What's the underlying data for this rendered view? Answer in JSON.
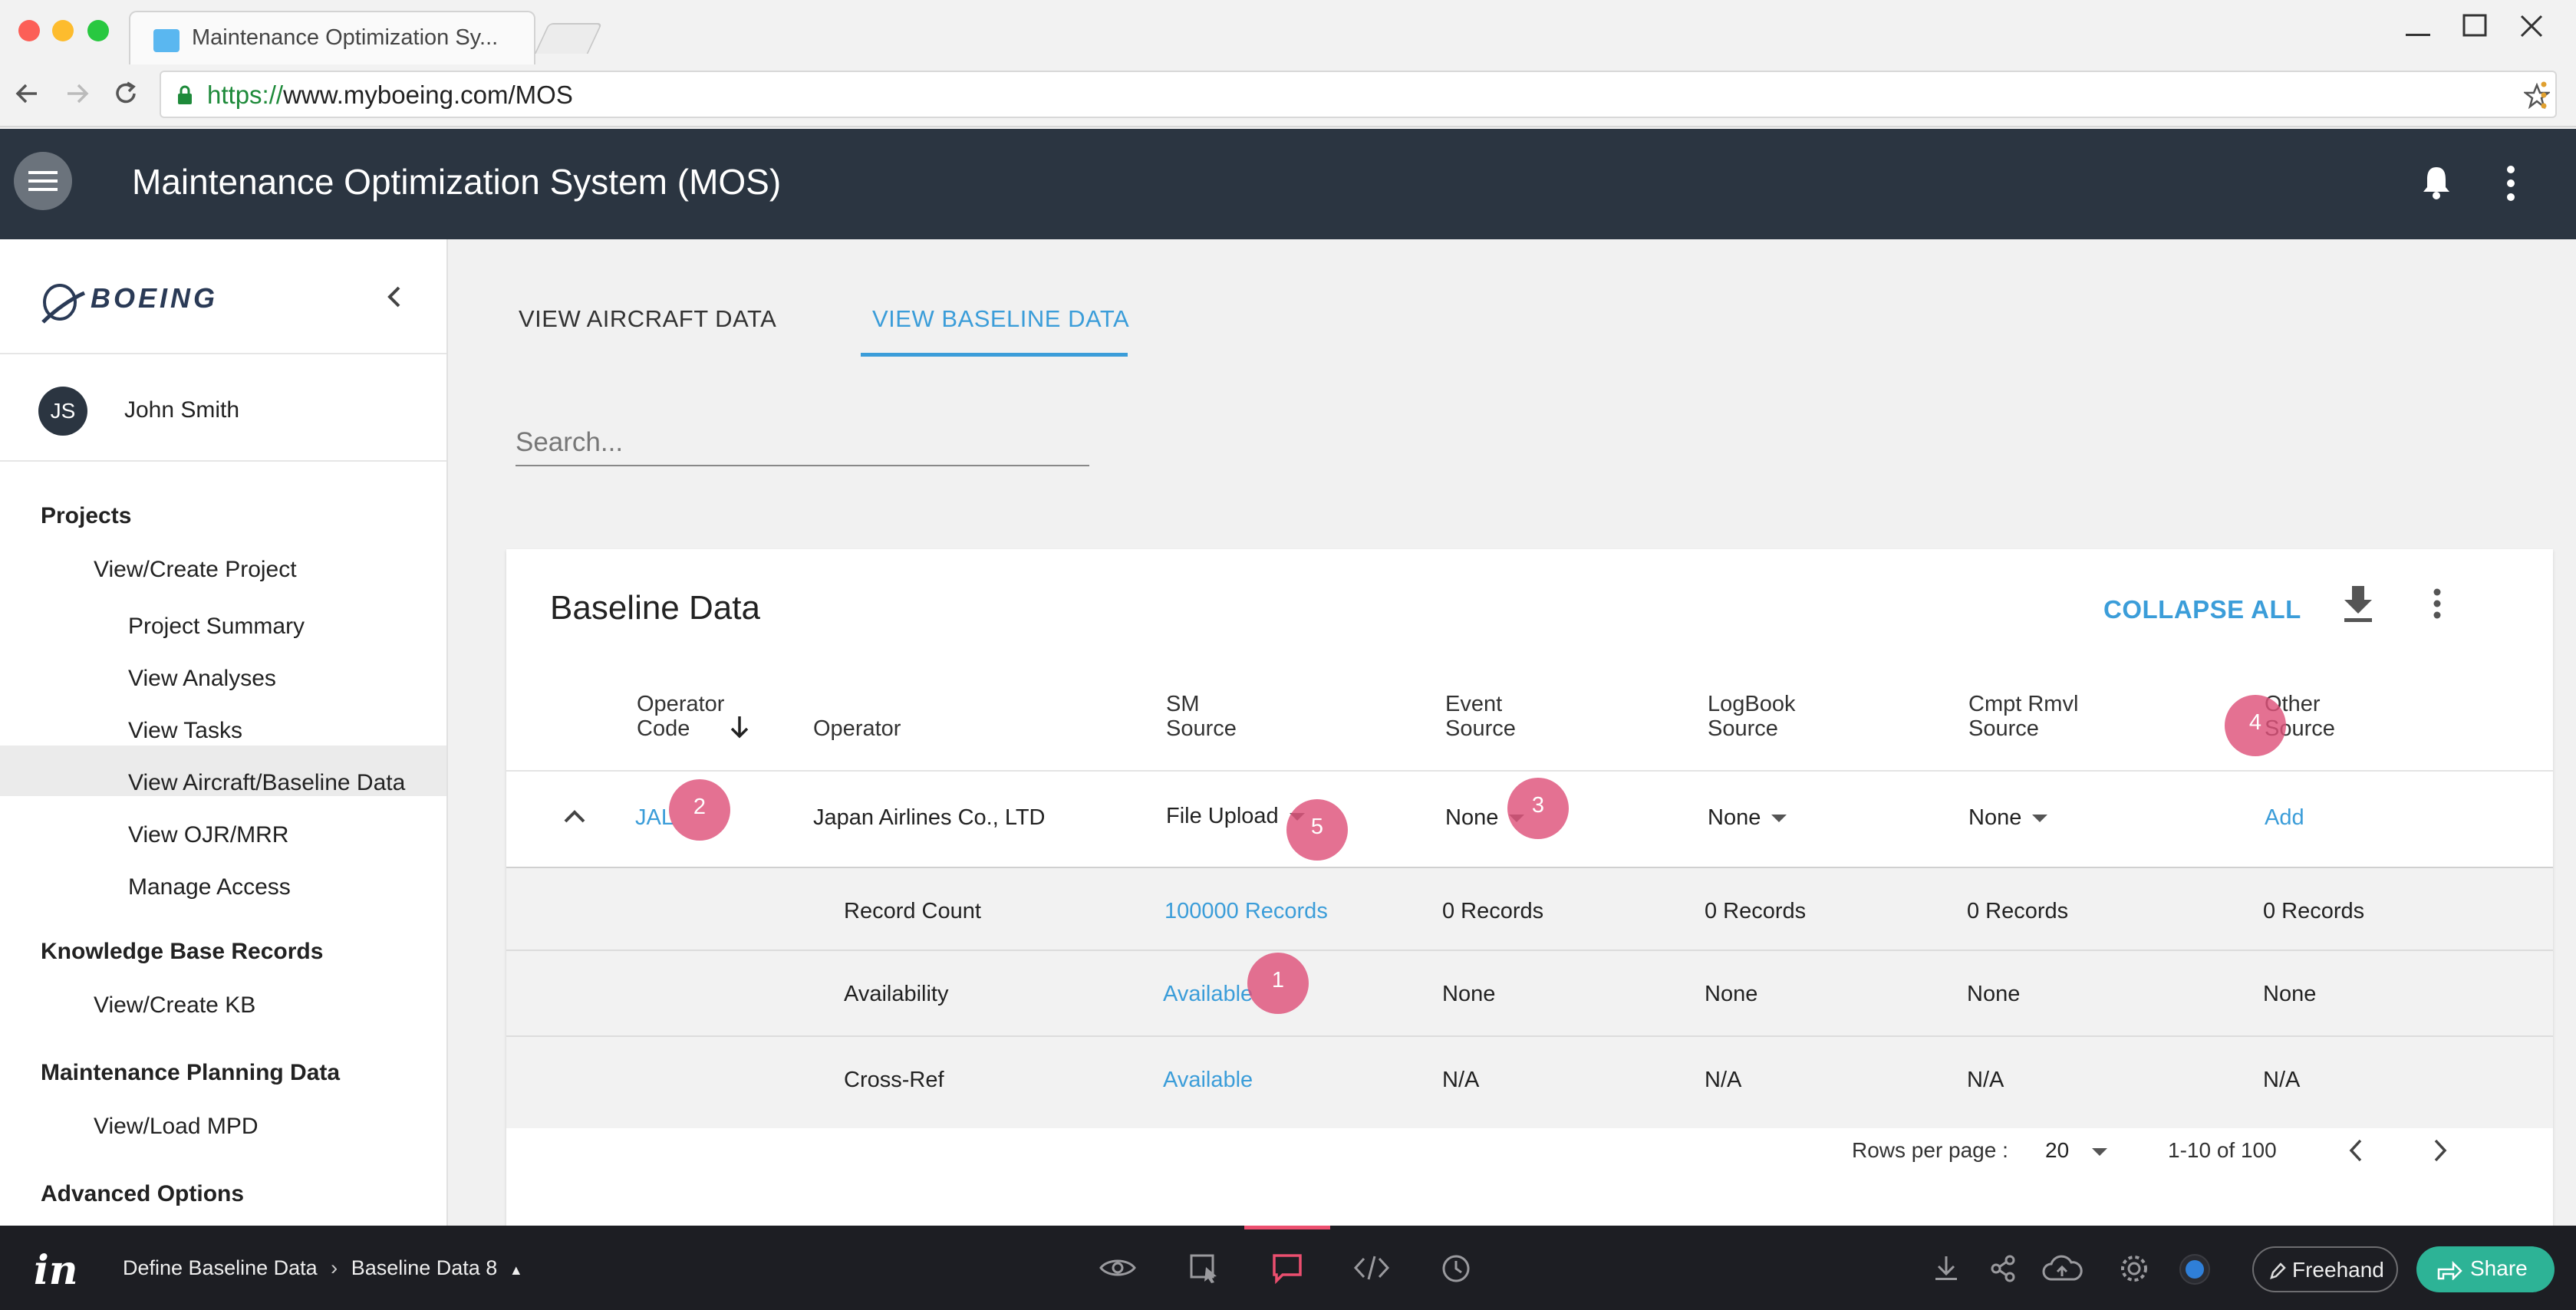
{
  "browser": {
    "tab_title": "Maintenance Optimization Sy...",
    "url_scheme": "https://",
    "url_rest": "www.myboeing.com/MOS"
  },
  "app": {
    "title": "Maintenance Optimization System (MOS)",
    "logo_text": "BOEING"
  },
  "user": {
    "initials": "JS",
    "name": "John Smith"
  },
  "nav": {
    "projects": "Projects",
    "view_create_project": "View/Create Project",
    "project_summary": "Project Summary",
    "view_analyses": "View Analyses",
    "view_tasks": "View Tasks",
    "view_aircraft_baseline": "View Aircraft/Baseline Data",
    "view_ojr_mrr": "View OJR/MRR",
    "manage_access": "Manage Access",
    "kb_records": "Knowledge Base Records",
    "view_create_kb": "View/Create KB",
    "mpd": "Maintenance Planning Data",
    "view_load_mpd": "View/Load MPD",
    "advanced": "Advanced Options"
  },
  "tabs": {
    "aircraft": "VIEW AIRCRAFT DATA",
    "baseline": "VIEW BASELINE DATA"
  },
  "search": {
    "placeholder": "Search..."
  },
  "card": {
    "title": "Baseline Data",
    "collapse_all": "COLLAPSE ALL",
    "columns": {
      "operator_code_1": "Operator",
      "operator_code_2": "Code",
      "operator": "Operator",
      "sm_1": "SM",
      "sm_2": "Source",
      "event_1": "Event",
      "event_2": "Source",
      "logbook_1": "LogBook",
      "logbook_2": "Source",
      "cmpt_1": "Cmpt Rmvl",
      "cmpt_2": "Source",
      "other_1": "Other",
      "other_2": "Source"
    },
    "row": {
      "operator_code": "JAL",
      "operator": "Japan Airlines Co., LTD",
      "sm_source": "File Upload",
      "event_source": "None",
      "logbook_source": "None",
      "cmpt_source": "None",
      "other_source": "Add"
    },
    "details": [
      {
        "label": "Record Count",
        "sm": "100000 Records",
        "event": "0 Records",
        "logbook": "0 Records",
        "cmpt": "0 Records",
        "other": "0 Records"
      },
      {
        "label": "Availability",
        "sm": "Available",
        "event": "None",
        "logbook": "None",
        "cmpt": "None",
        "other": "None"
      },
      {
        "label": "Cross-Ref",
        "sm": "Available",
        "event": "N/A",
        "logbook": "N/A",
        "cmpt": "N/A",
        "other": "N/A"
      }
    ],
    "pagination": {
      "rows_per_page_label": "Rows per page :",
      "rows_per_page": "20",
      "range": "1-10 of 100"
    }
  },
  "hotspots": [
    "1",
    "2",
    "3",
    "4",
    "5"
  ],
  "invision": {
    "logo": "in",
    "crumb_section": "Define Baseline Data",
    "crumb_screen": "Baseline Data 8",
    "freehand": "Freehand",
    "share": "Share"
  },
  "colors": {
    "appbar": "#2b3541",
    "accent": "#3b9dd9",
    "hotspot": "#de527a",
    "share": "#2db396"
  }
}
